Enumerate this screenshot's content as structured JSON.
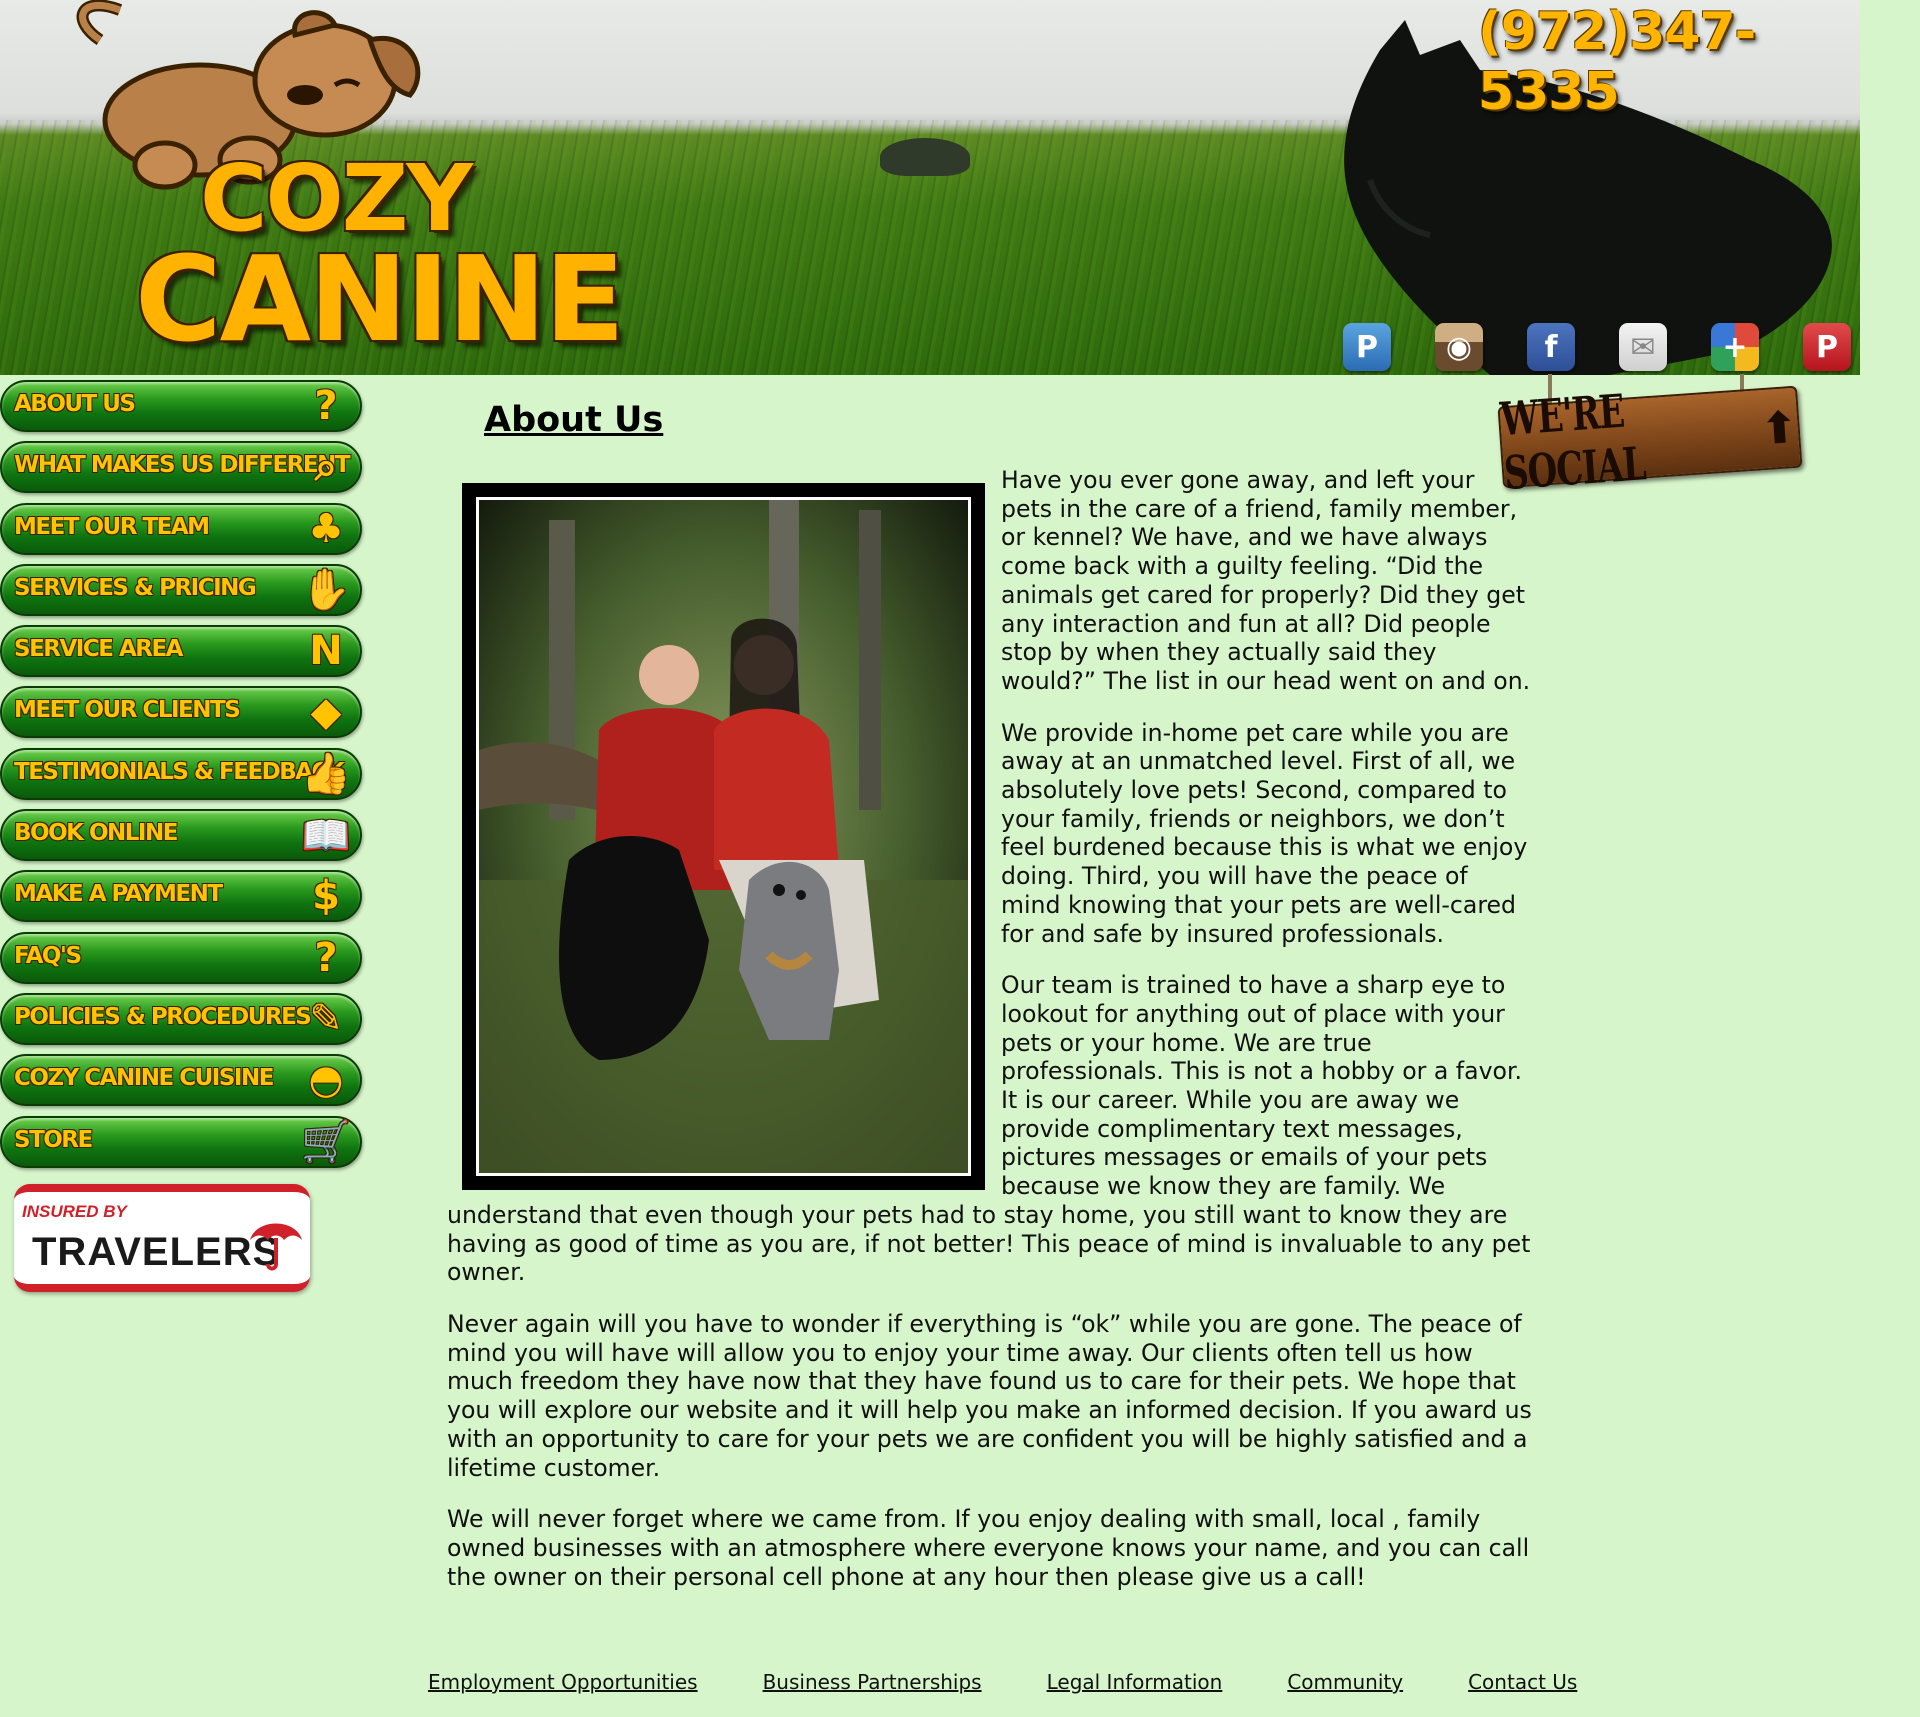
{
  "header": {
    "logo": {
      "line1": "COZY",
      "line2": "CANINE"
    },
    "phone": "(972)347-5335",
    "social_icons": [
      {
        "name": "p-icon",
        "glyph": "P"
      },
      {
        "name": "instagram-icon",
        "glyph": "◉"
      },
      {
        "name": "facebook-icon",
        "glyph": "f"
      },
      {
        "name": "email-icon",
        "glyph": "✉"
      },
      {
        "name": "google-plus-icon",
        "glyph": "+"
      },
      {
        "name": "pinterest-icon",
        "glyph": "P"
      }
    ],
    "social_sign": "WE'RE SOCIAL"
  },
  "nav": {
    "items": [
      {
        "label": "About Us",
        "icon": "question-icon",
        "glyph": "?"
      },
      {
        "label": "What Makes Us Different",
        "icon": "magnifier-icon",
        "glyph": "⌕"
      },
      {
        "label": "Meet Our Team",
        "icon": "team-icon",
        "glyph": "♣"
      },
      {
        "label": "Services & Pricing",
        "icon": "handshake-icon",
        "glyph": "✋"
      },
      {
        "label": "Service Area",
        "icon": "texas-map-icon",
        "glyph": "N"
      },
      {
        "label": "Meet Our Clients",
        "icon": "dog-icon",
        "glyph": "◆"
      },
      {
        "label": "Testimonials & Feedback",
        "icon": "thumbs-up-icon",
        "glyph": "👍"
      },
      {
        "label": "Book Online",
        "icon": "book-icon",
        "glyph": "📖"
      },
      {
        "label": "Make a Payment",
        "icon": "money-icon",
        "glyph": "$"
      },
      {
        "label": "FAQ's",
        "icon": "thinker-icon",
        "glyph": "?"
      },
      {
        "label": "Policies & Procedures",
        "icon": "quill-icon",
        "glyph": "✎"
      },
      {
        "label": "Cozy Canine Cuisine",
        "icon": "food-bowl-icon",
        "glyph": "◓"
      },
      {
        "label": "Store",
        "icon": "cart-icon",
        "glyph": "🛒"
      }
    ]
  },
  "insured": {
    "by": "INSURED BY",
    "brand": "TRAVELERS"
  },
  "main": {
    "title": "About Us",
    "paragraphs": [
      "Have you ever gone away, and left your pets in the care of a friend, family member, or kennel? We have, and we have always come back with a guilty feeling. “Did the animals get cared for properly? Did they get any interaction and fun at all? Did people stop by when they actually said they would?” The list in our head went on and on.",
      "We provide in-home pet care while you are away at an unmatched level. First of all, we absolutely love pets! Second, compared to your family, friends or neighbors, we don’t feel burdened because this is what we enjoy doing. Third, you will have the peace of mind knowing that your pets are well-cared for and safe by insured professionals.",
      "Our team is trained to have a sharp eye to lookout for anything out of place with your pets or your home. We are true professionals. This is not a hobby or a favor. It is our career. While you are away we provide complimentary text messages, pictures messages or emails of your pets because we know they are family. We understand that even though your pets had to stay home, you still want to know they are having as good of time as you are, if not better! This peace of mind is invaluable to any pet owner.",
      "Never again will you have to wonder if everything is “ok” while you are gone. The peace of mind you will have will allow you to enjoy your time away. Our clients often tell us how much freedom they have now that they have found us to care for their pets. We hope that you will explore our website and it will help you make an informed decision. If you award us with an opportunity to care for your pets we are confident you will be highly satisfied and a lifetime customer.",
      "We will never forget where we came from. If you enjoy dealing with small, local , family owned businesses with an atmosphere where everyone knows your name, and you can call the owner on their personal cell phone at any hour then please give us a call!"
    ]
  },
  "footer": {
    "links": [
      "Employment Opportunities",
      "Business Partnerships",
      "Legal Information",
      "Community",
      "Contact Us"
    ]
  },
  "colors": {
    "page_bg": "#d7f5cb",
    "accent_gold": "#ffb300",
    "nav_green": "#0f7410",
    "travelers_red": "#d0202a"
  }
}
